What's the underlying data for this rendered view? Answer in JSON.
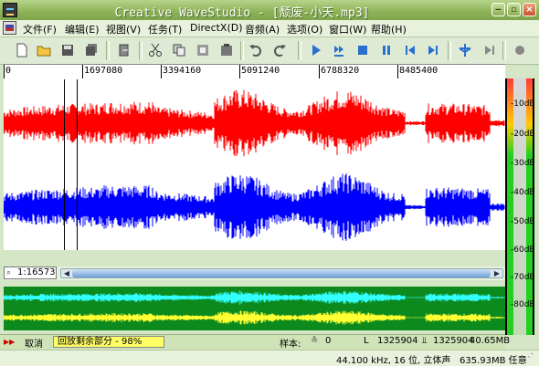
{
  "window": {
    "title": "Creative WaveStudio - [颓废-小天.mp3]",
    "controls": [
      "minimize-icon",
      "maximize-icon",
      "close-icon"
    ]
  },
  "menu": {
    "items": [
      "文件(F)",
      "编辑(E)",
      "视图(V)",
      "任务(T)",
      "DirectX(D)",
      "音频(A)",
      "选项(O)",
      "窗口(W)",
      "帮助(H)"
    ]
  },
  "toolbar": {
    "buttons": [
      "new-icon",
      "open-icon",
      "save-icon",
      "save-all-icon",
      "copy-clip-icon",
      "cut-icon",
      "copy-icon",
      "paste-icon",
      "mix-paste-icon",
      "undo-icon",
      "redo-icon",
      "play-icon",
      "play-loop-icon",
      "stop-icon",
      "pause-icon",
      "skip-back-icon",
      "skip-forward-icon",
      "marker-icon",
      "next-icon",
      "record-icon"
    ]
  },
  "ruler": {
    "labels": [
      "0",
      "1697080",
      "3394160",
      "5091240",
      "6788320",
      "8485400"
    ]
  },
  "meter": {
    "labels": [
      "-10dB",
      "-20dB",
      "-30dB",
      "-40dB",
      "-50dB",
      "-60dB",
      "-70dB",
      "-80dB"
    ]
  },
  "position": {
    "value": "1:16573"
  },
  "status": {
    "cancel": "取消",
    "progress_text": "回放剩余部分 - 98%",
    "progress": 0.98,
    "sample_label": "样本:",
    "sample_value": "0",
    "selection_start": "1325904",
    "selection_end": "1325904",
    "file_size": "40.65MB"
  },
  "status2": {
    "format": "44.100 kHz, 16 位, 立体声",
    "free": "635.93MB 任意"
  },
  "colors": {
    "left_channel": "#ff0000",
    "right_channel": "#0000ff",
    "overview_bg": "#0c8a1e",
    "overview_top": "#33ffff",
    "overview_bottom": "#ffff33",
    "progress_fill": "#ffff66"
  }
}
